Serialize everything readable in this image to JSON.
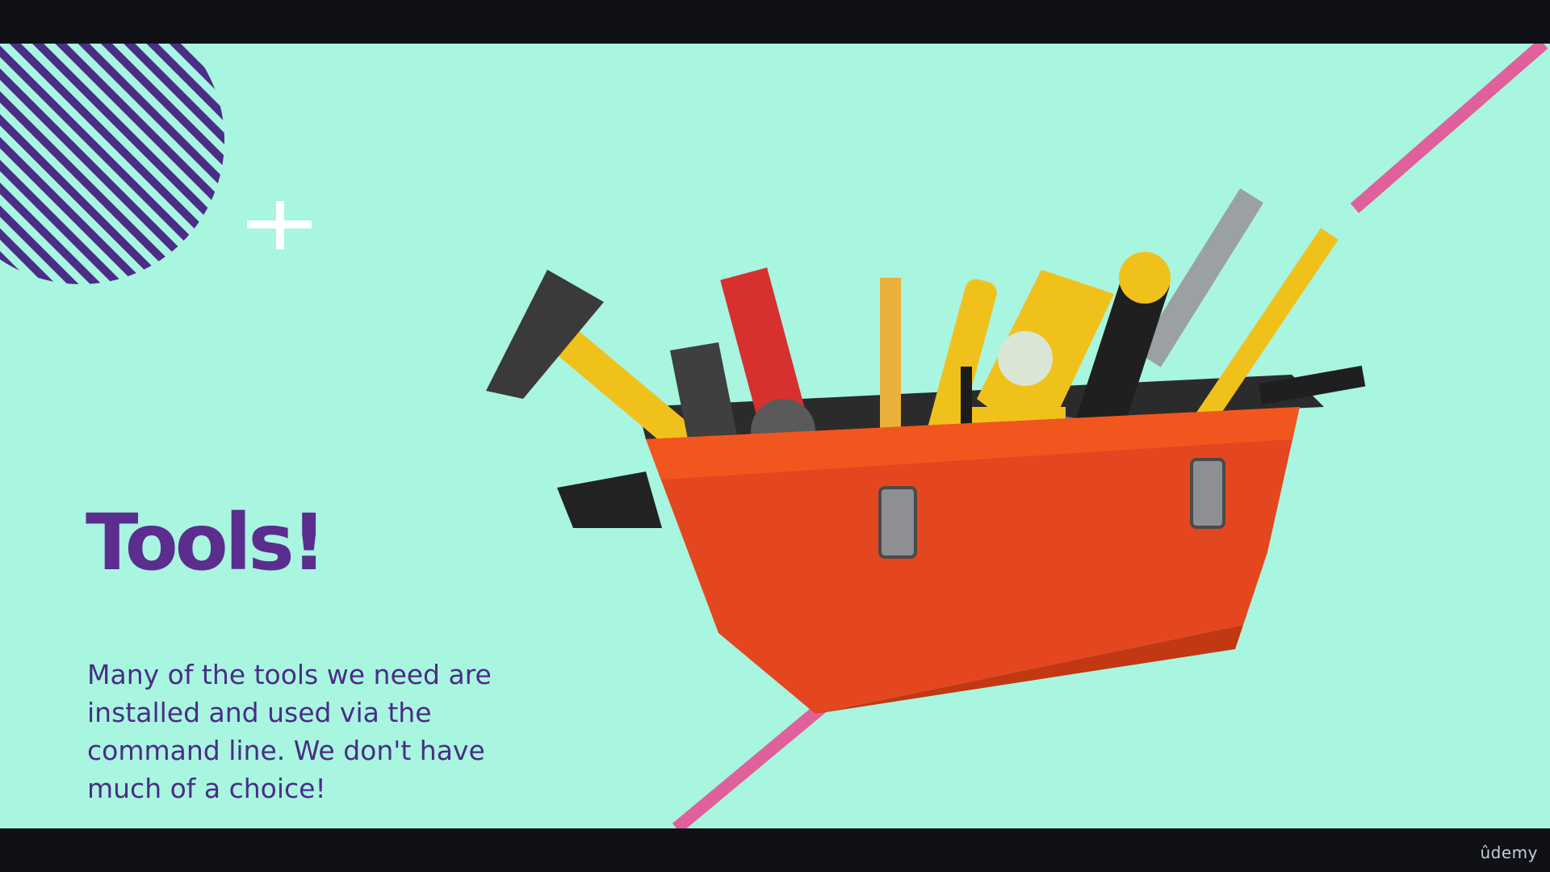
{
  "slide": {
    "title": "Tools!",
    "body": "Many of the tools we need are\ninstalled and used via the\ncommand line.  We don't have\nmuch of a choice!"
  },
  "player": {
    "brand": "ûdemy"
  },
  "decorations": {
    "accent_pink": "#e0609b",
    "accent_purple": "#4a2d86",
    "background": "#a8f5e0",
    "plus_icon": "plus-icon",
    "toolbox_image": "toolbox-illustration"
  }
}
